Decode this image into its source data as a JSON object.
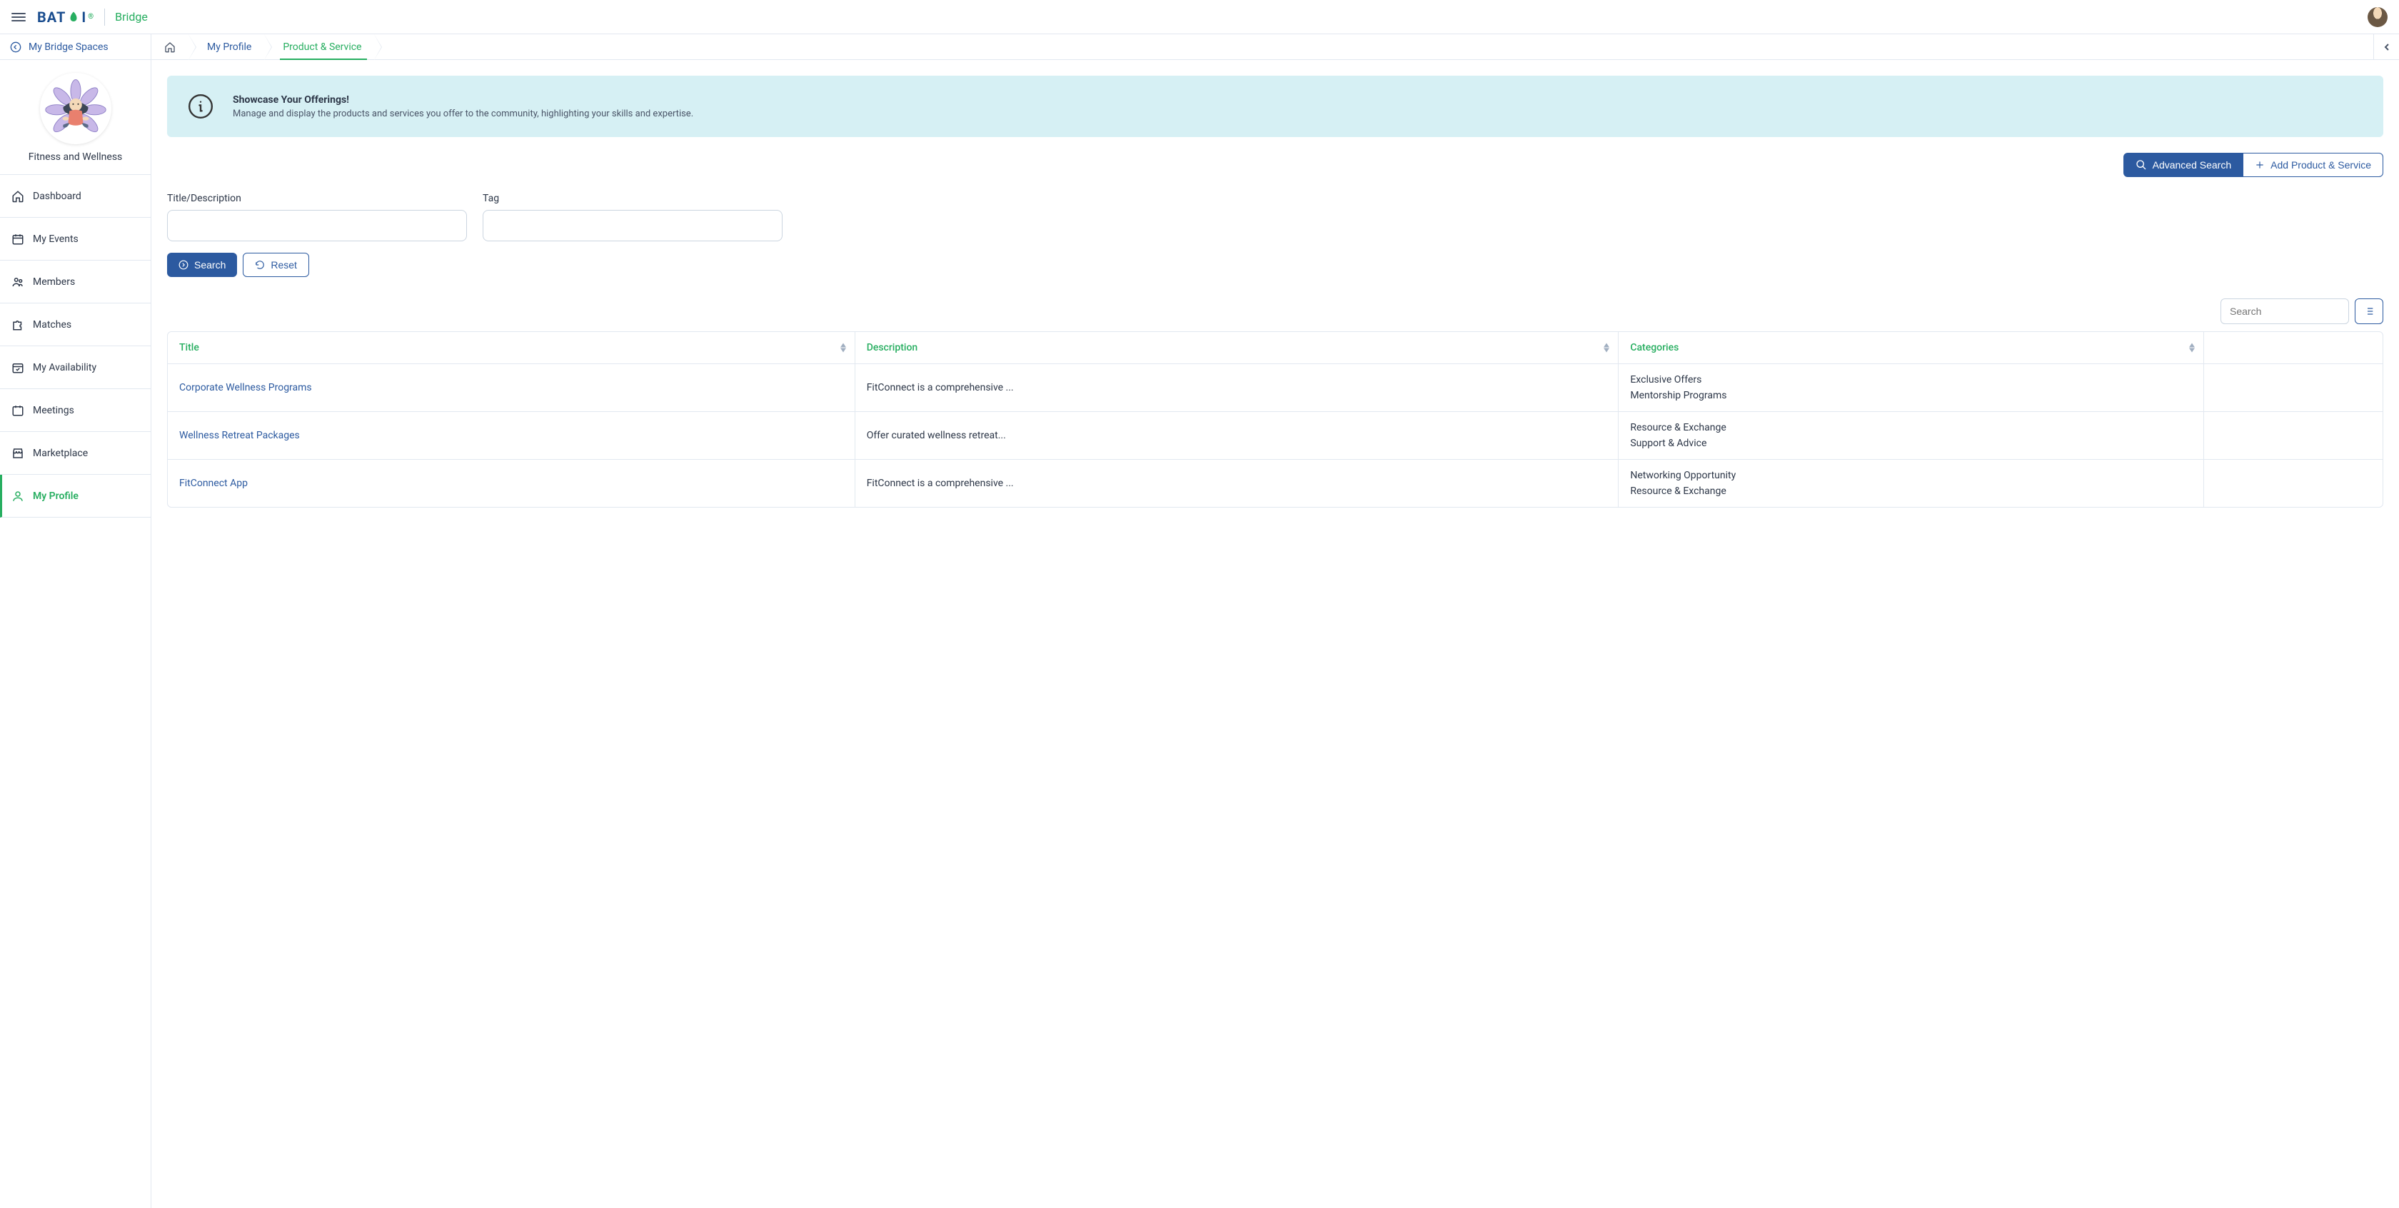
{
  "header": {
    "logo_prefix": "BAT",
    "logo_suffix": "I",
    "app_name": "Bridge"
  },
  "sidebar": {
    "top_link": "My Bridge Spaces",
    "profile_name": "Fitness and Wellness",
    "items": [
      {
        "label": "Dashboard"
      },
      {
        "label": "My Events"
      },
      {
        "label": "Members"
      },
      {
        "label": "Matches"
      },
      {
        "label": "My Availability"
      },
      {
        "label": "Meetings"
      },
      {
        "label": "Marketplace"
      },
      {
        "label": "My Profile"
      }
    ]
  },
  "breadcrumb": {
    "my_profile": "My Profile",
    "current": "Product & Service"
  },
  "banner": {
    "title": "Showcase Your Offerings!",
    "text": "Manage and display the products and services you offer to the community, highlighting your skills and expertise."
  },
  "actions": {
    "advanced_search": "Advanced Search",
    "add": "Add Product & Service"
  },
  "filters": {
    "title_label": "Title/Description",
    "tag_label": "Tag",
    "search_btn": "Search",
    "reset_btn": "Reset"
  },
  "table_toolbar": {
    "search_placeholder": "Search"
  },
  "table": {
    "headers": {
      "title": "Title",
      "description": "Description",
      "categories": "Categories"
    },
    "rows": [
      {
        "title": "Corporate Wellness Programs",
        "description": "FitConnect is a comprehensive ...",
        "categories": [
          "Exclusive Offers",
          "Mentorship Programs"
        ]
      },
      {
        "title": "Wellness Retreat Packages",
        "description": "Offer curated wellness retreat...",
        "categories": [
          "Resource & Exchange",
          "Support & Advice"
        ]
      },
      {
        "title": "FitConnect App",
        "description": "FitConnect is a comprehensive ...",
        "categories": [
          "Networking Opportunity",
          "Resource & Exchange"
        ]
      }
    ]
  }
}
